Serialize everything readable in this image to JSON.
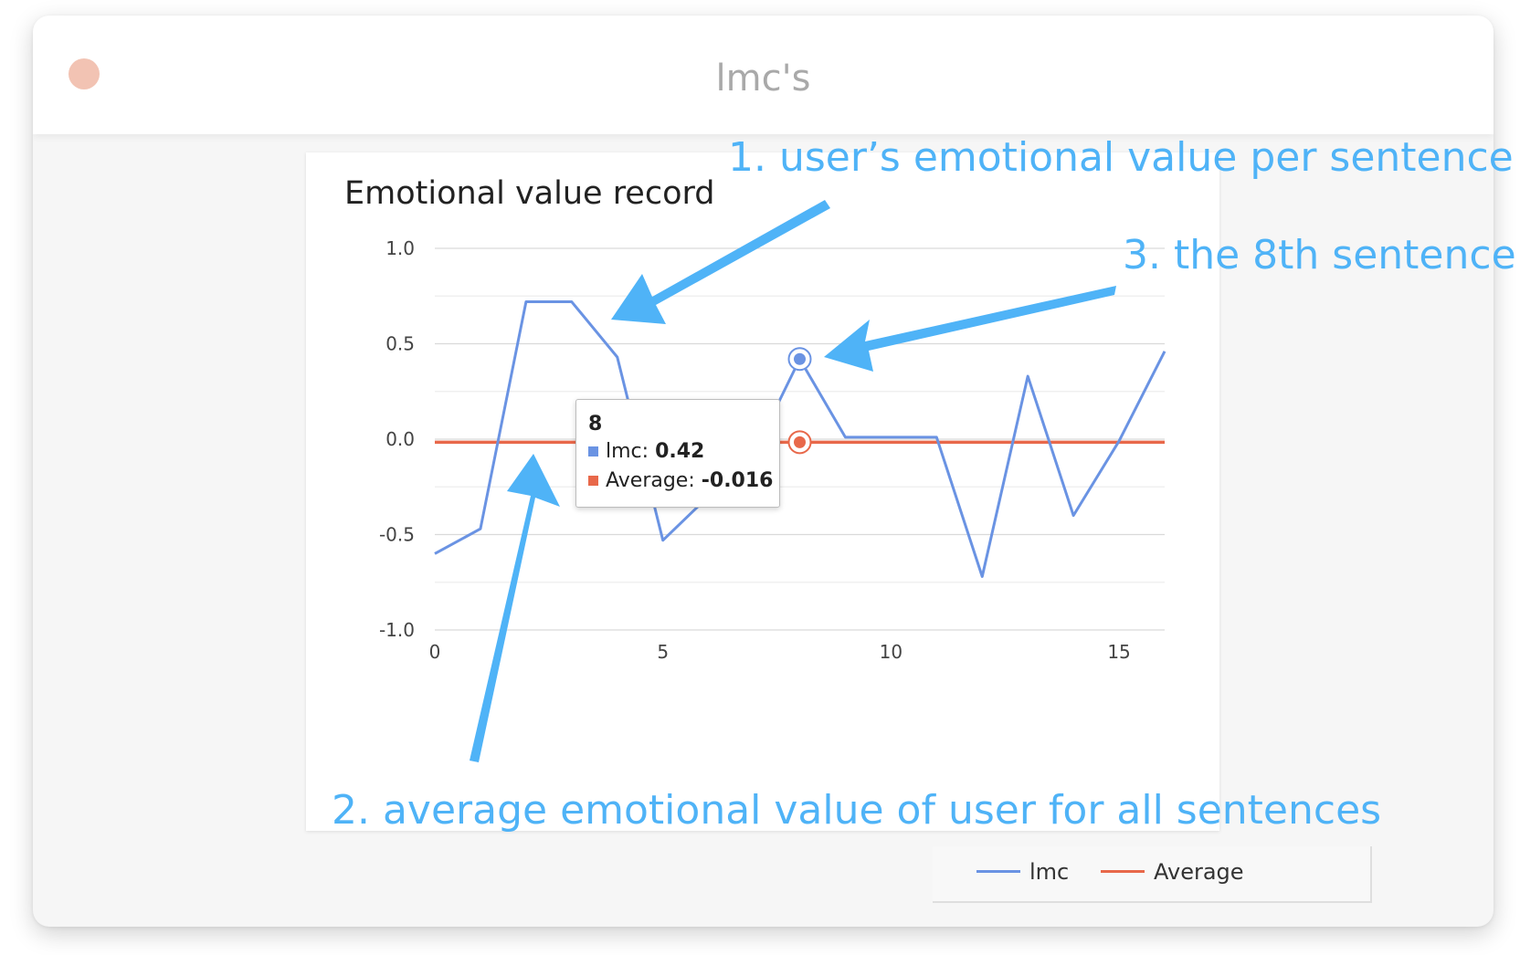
{
  "window": {
    "title": "lmc's"
  },
  "chart_data": {
    "type": "line",
    "title": "Emotional value record",
    "xlabel": "",
    "ylabel": "",
    "x": [
      0,
      1,
      2,
      3,
      4,
      5,
      6,
      7,
      8,
      9,
      10,
      11,
      12,
      13,
      14,
      15,
      16
    ],
    "xlim": [
      0,
      16
    ],
    "ylim": [
      -1.0,
      1.0
    ],
    "xticks": [
      "0",
      "5",
      "10",
      "15"
    ],
    "yticks": [
      "1.0",
      "0.5",
      "0.0",
      "-0.5",
      "-1.0"
    ],
    "grid": true,
    "legend_position": "bottom",
    "series": [
      {
        "name": "lmc",
        "color": "#6a93e3",
        "values": [
          -0.6,
          -0.47,
          0.72,
          0.72,
          0.43,
          -0.53,
          -0.3,
          -0.07,
          0.42,
          0.01,
          0.01,
          0.01,
          -0.72,
          0.33,
          -0.4,
          -0.01,
          0.46
        ]
      },
      {
        "name": "Average",
        "color": "#e8684a",
        "values": [
          -0.016,
          -0.016,
          -0.016,
          -0.016,
          -0.016,
          -0.016,
          -0.016,
          -0.016,
          -0.016,
          -0.016,
          -0.016,
          -0.016,
          -0.016,
          -0.016,
          -0.016,
          -0.016,
          -0.016
        ]
      }
    ],
    "highlight_index": 8
  },
  "tooltip": {
    "x": "8",
    "series1_label": "lmc:",
    "series1_value": "0.42",
    "series2_label": "Average:",
    "series2_value": "-0.016"
  },
  "legend": {
    "items": [
      "lmc",
      "Average"
    ]
  },
  "annotations": {
    "note1": "1. user’s emotional value per sentence",
    "note2": "2. average emotional value of user for all sentences",
    "note3": "3. the 8th sentence",
    "arrow_color": "#4fb3f7"
  }
}
